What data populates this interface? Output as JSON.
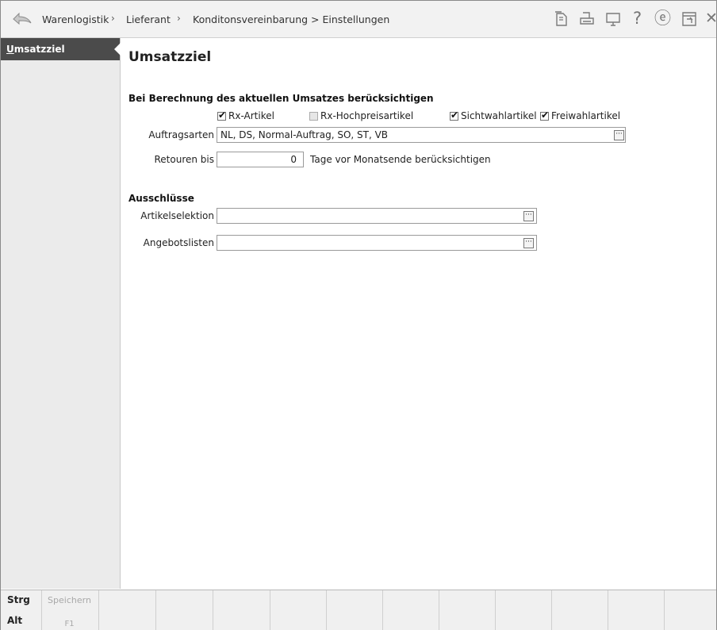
{
  "breadcrumb": {
    "items": [
      "Warenlogistik",
      "Lieferant",
      "Konditonsvereinbarung > Einstellungen"
    ],
    "separator": "›"
  },
  "toolbar": {
    "icons": [
      "copy-document-icon",
      "print-icon",
      "monitor-icon",
      "help-icon",
      "e-icon",
      "window-icon",
      "close-icon"
    ],
    "help_glyph": "?",
    "e_glyph": "ⓔ",
    "close_glyph": "✕"
  },
  "sidebar": {
    "items": [
      {
        "label_prefix": "U",
        "label_rest": "msatzziel"
      }
    ]
  },
  "main": {
    "title": "Umsatzziel",
    "section_berechnung": "Bei Berechnung des aktuellen Umsatzes berücksichtigen",
    "checkboxes": [
      {
        "label": "Rx-Artikel",
        "checked": true
      },
      {
        "label": "Rx-Hochpreisartikel",
        "checked": false
      },
      {
        "label": "Sichtwahlartikel",
        "checked": true
      },
      {
        "label": "Freiwahlartikel",
        "checked": true
      }
    ],
    "auftragsarten_label": "Auftragsarten",
    "auftragsarten_value": "NL, DS, Normal-Auftrag, SO, ST, VB",
    "retouren_label": "Retouren bis",
    "retouren_value": "0",
    "retouren_suffix": "Tage vor Monatsende berücksichtigen",
    "section_ausschluesse": "Ausschlüsse",
    "artikelselektion_label": "Artikelselektion",
    "artikelselektion_value": "",
    "angebotslisten_label": "Angebotslisten",
    "angebotslisten_value": "",
    "dots_glyph": "···"
  },
  "fbar": {
    "modifier_strg": "Strg",
    "modifier_alt": "Alt",
    "keys": [
      {
        "label": "Speichern",
        "key": "F1"
      },
      {
        "label": "",
        "key": ""
      },
      {
        "label": "",
        "key": ""
      },
      {
        "label": "",
        "key": ""
      },
      {
        "label": "",
        "key": ""
      },
      {
        "label": "",
        "key": ""
      },
      {
        "label": "",
        "key": ""
      },
      {
        "label": "",
        "key": ""
      },
      {
        "label": "",
        "key": ""
      },
      {
        "label": "",
        "key": ""
      },
      {
        "label": "",
        "key": ""
      },
      {
        "label": "",
        "key": ""
      }
    ]
  }
}
